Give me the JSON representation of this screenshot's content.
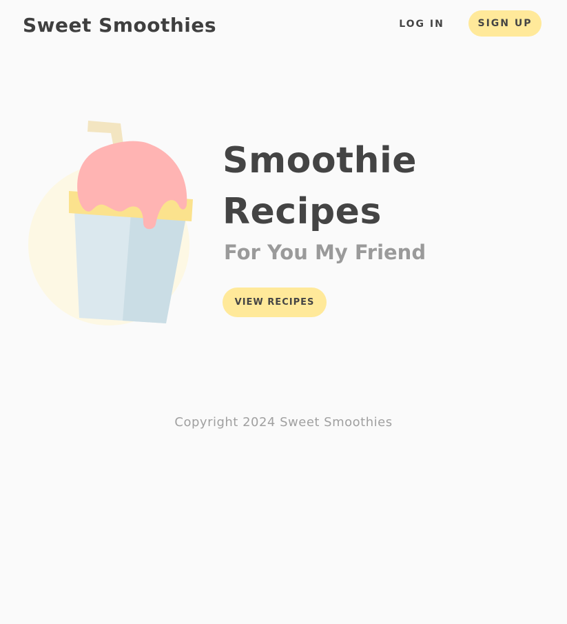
{
  "header": {
    "brand": "Sweet Smoothies",
    "login_label": "LOG IN",
    "signup_label": "SIGN UP"
  },
  "hero": {
    "title_line1": "Smoothie",
    "title_line2": "Recipes",
    "subtitle": "For You My Friend",
    "cta_label": "VIEW RECIPES",
    "illustration_icon": "smoothie-cup-icon"
  },
  "footer": {
    "copyright": "Copyright 2024 Sweet Smoothies"
  },
  "colors": {
    "accent_yellow": "#ffe99a",
    "text_dark": "#444444",
    "text_muted": "#9a9a9a",
    "background": "#fafafa",
    "cup_blue": "#dbe8ee",
    "cup_blue_shade": "#cadde5",
    "topping_pink": "#ffb4b3",
    "rim_yellow": "#fbe28d",
    "straw": "#f3e5c1",
    "halo": "#fdf8e4"
  }
}
